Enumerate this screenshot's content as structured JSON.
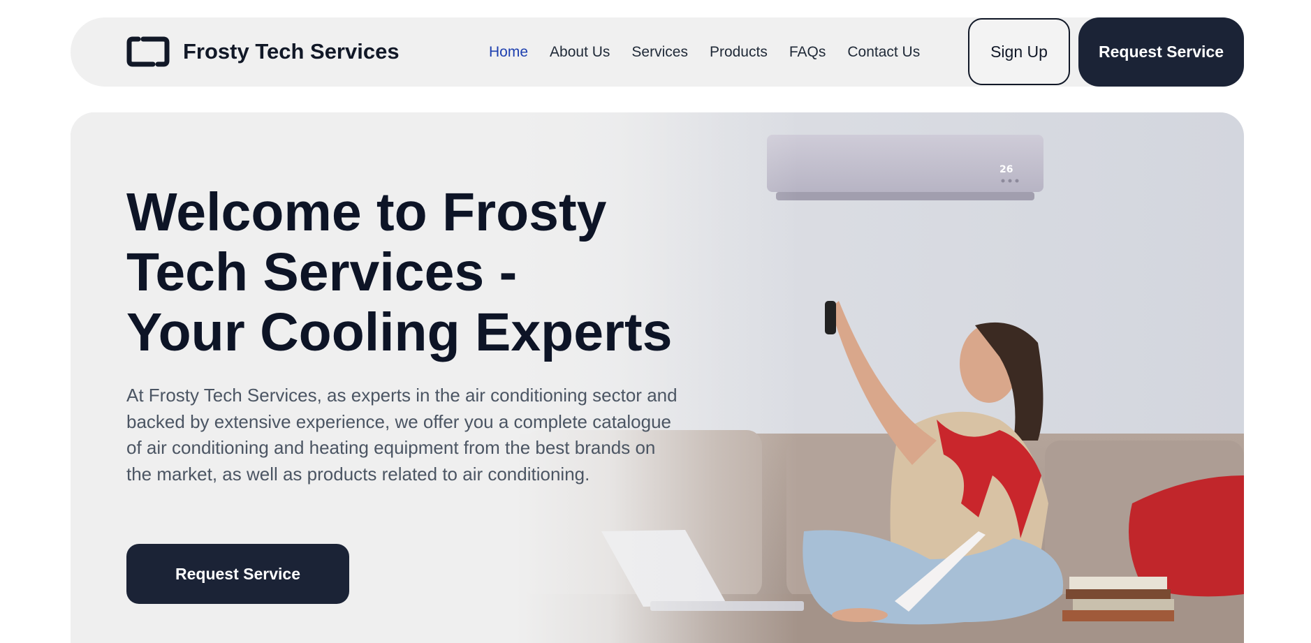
{
  "header": {
    "brand": "Frosty Tech Services",
    "nav": [
      {
        "label": "Home",
        "active": true
      },
      {
        "label": "About Us"
      },
      {
        "label": "Services"
      },
      {
        "label": "Products"
      },
      {
        "label": "FAQs"
      },
      {
        "label": "Contact Us"
      }
    ],
    "signup_label": "Sign Up",
    "request_label": "Request Service"
  },
  "hero": {
    "title_lines": [
      "Welcome to Frosty",
      "Tech Services -",
      "Your Cooling Experts"
    ],
    "description": "At Frosty Tech Services, as experts in the air conditioning sector and backed by extensive experience, we offer you a complete catalogue of air conditioning and heating equipment from the best brands on the market, as well as products related to air conditioning.",
    "cta_label": "Request Service",
    "ac_display": "26"
  },
  "colors": {
    "primary": "#1b2336",
    "nav_active": "#1e40af",
    "surface": "#f0f0f0"
  }
}
